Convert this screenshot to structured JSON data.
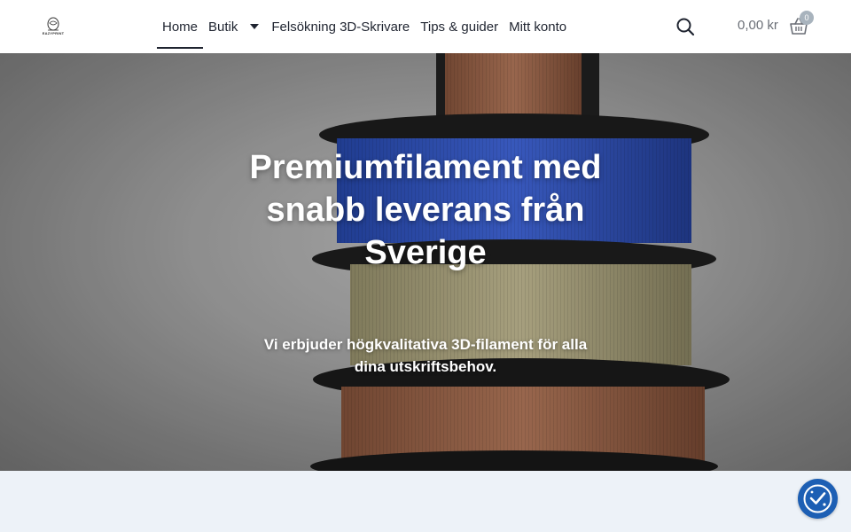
{
  "brand": {
    "logo_text": "EAZYPRINT"
  },
  "nav": {
    "items": [
      {
        "label": "Home",
        "active": true
      },
      {
        "label": "Butik",
        "has_dropdown": true
      },
      {
        "label": "Felsökning 3D-Skrivare"
      },
      {
        "label": "Tips & guider"
      },
      {
        "label": "Mitt konto"
      }
    ]
  },
  "header_actions": {
    "search_icon": "search-icon",
    "cart_total": "0,00 kr",
    "cart_count": "0",
    "cart_icon": "shopping-basket-icon"
  },
  "hero": {
    "title": "Premiumfilament med snabb leverans från Sverige",
    "subtitle": "Vi erbjuder högkvalitativa 3D-filament för alla dina utskriftsbehov."
  },
  "consent": {
    "icon": "cookie-consent-icon"
  },
  "colors": {
    "nav_text": "#1f2430",
    "cart_badge": "#a8b3bd",
    "below_section": "#edf2f8",
    "consent_button": "#1d5fb4"
  }
}
